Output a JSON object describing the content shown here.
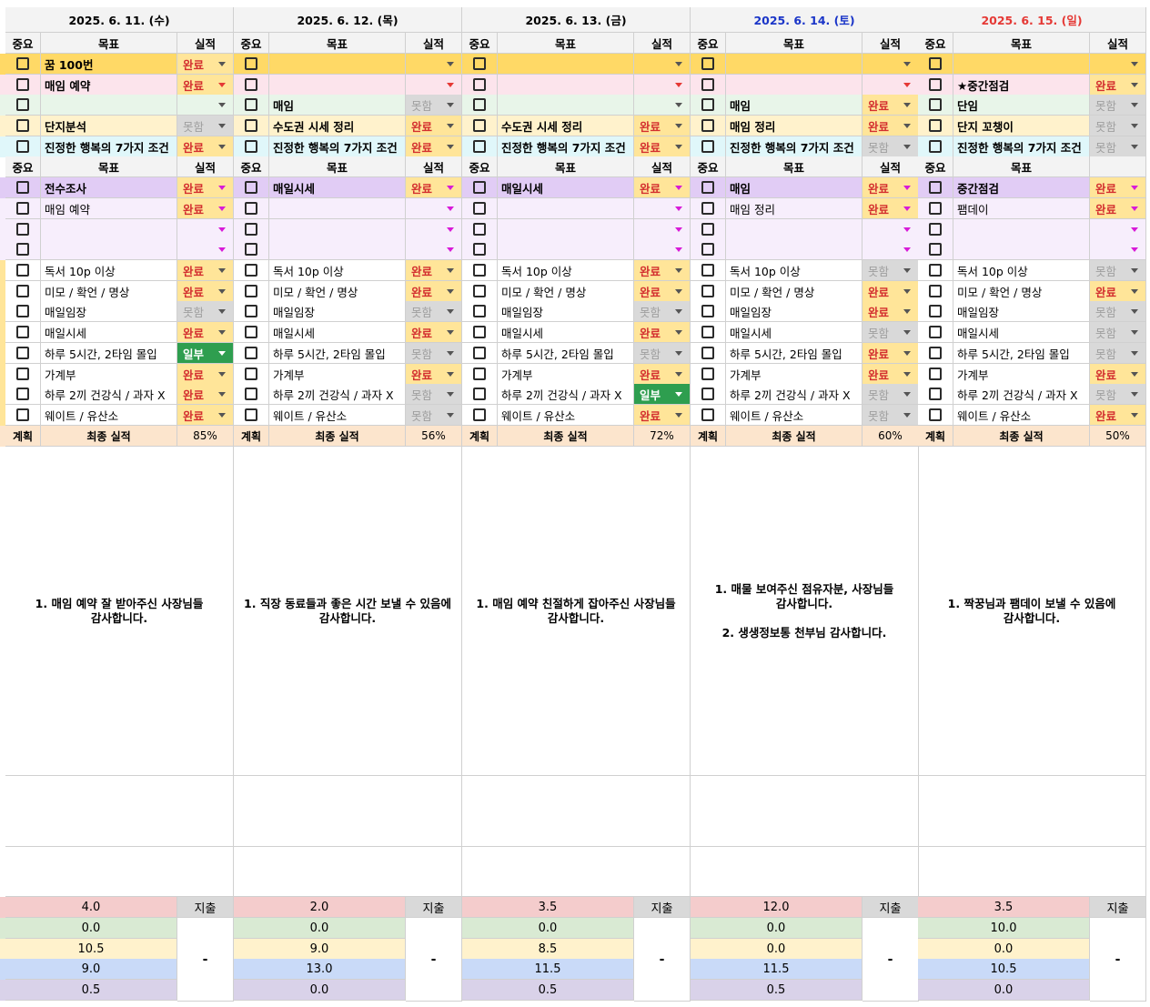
{
  "headers": {
    "importance": "중요",
    "goal": "목표",
    "result": "실적",
    "plan": "계획",
    "final": "최종 실적",
    "spend": "지출"
  },
  "days": [
    {
      "date": "2025. 6. 11. (수)",
      "date_color": "#000000",
      "top": [
        {
          "goal": "꿈 100번",
          "result": "완료",
          "bg": "#ffd966",
          "goal_bold": true,
          "caret": "dark"
        },
        {
          "goal": "매임 예약",
          "result": "완료",
          "bg": "#fce4ec",
          "goal_bold": true,
          "caret": "red"
        },
        {
          "goal": "",
          "result": "",
          "bg": "#e8f5e9",
          "goal_bold": true,
          "caret": "dark"
        },
        {
          "goal": "단지분석",
          "result": "못함",
          "bg": "#fff2cc",
          "goal_bold": true,
          "caret": "dark"
        },
        {
          "goal": "진정한 행복의 7가지 조건",
          "result": "완료",
          "bg": "#e0f7fa",
          "goal_bold": true,
          "caret": "dark"
        }
      ],
      "mid_header_result": "실적",
      "mid": [
        {
          "goal": "전수조사",
          "result": "완료",
          "bg": "#e1ccf5",
          "goal_bold": true
        },
        {
          "goal": "매임 예약",
          "result": "완료",
          "bg": "#f7eefc",
          "goal_bold": false
        },
        {
          "goal": "",
          "result": "",
          "bg": "#f7eefc",
          "goal_bold": false
        },
        {
          "goal": "",
          "result": "",
          "bg": "#f7eefc",
          "goal_bold": false
        }
      ],
      "habits": [
        "완료",
        "완료",
        "못함",
        "완료",
        "일부",
        "완료",
        "완료",
        "완료"
      ],
      "final_pct": "85%",
      "thanks": "1. 매임 예약 잘 받아주신 사장님들\n감사합니다.",
      "money": [
        "4.0",
        "0.0",
        "10.5",
        "9.0",
        "0.5"
      ]
    },
    {
      "date": "2025. 6. 12. (목)",
      "date_color": "#000000",
      "top": [
        {
          "goal": "",
          "result": "",
          "bg": "#ffd966",
          "goal_bold": true,
          "caret": "dark"
        },
        {
          "goal": "",
          "result": "",
          "bg": "#fce4ec",
          "goal_bold": true,
          "caret": "red"
        },
        {
          "goal": "매임",
          "result": "못함",
          "bg": "#e8f5e9",
          "goal_bold": true,
          "caret": "dark"
        },
        {
          "goal": "수도권 시세 정리",
          "result": "완료",
          "bg": "#fff2cc",
          "goal_bold": true,
          "caret": "dark"
        },
        {
          "goal": "진정한 행복의 7가지 조건",
          "result": "완료",
          "bg": "#e0f7fa",
          "goal_bold": true,
          "caret": "dark"
        }
      ],
      "mid_header_result": "실적",
      "mid": [
        {
          "goal": "매일시세",
          "result": "완료",
          "bg": "#e1ccf5",
          "goal_bold": true
        },
        {
          "goal": "",
          "result": "",
          "bg": "#f7eefc",
          "goal_bold": false
        },
        {
          "goal": "",
          "result": "",
          "bg": "#f7eefc",
          "goal_bold": false
        },
        {
          "goal": "",
          "result": "",
          "bg": "#f7eefc",
          "goal_bold": false
        }
      ],
      "habits": [
        "완료",
        "완료",
        "못함",
        "완료",
        "못함",
        "완료",
        "못함",
        "못함"
      ],
      "final_pct": "56%",
      "thanks": "1. 직장 동료들과 좋은 시간 보낼 수 있음에\n감사합니다.",
      "money": [
        "2.0",
        "0.0",
        "9.0",
        "13.0",
        "0.0"
      ]
    },
    {
      "date": "2025. 6. 13. (금)",
      "date_color": "#000000",
      "top": [
        {
          "goal": "",
          "result": "",
          "bg": "#ffd966",
          "goal_bold": true,
          "caret": "dark"
        },
        {
          "goal": "",
          "result": "",
          "bg": "#fce4ec",
          "goal_bold": true,
          "caret": "red"
        },
        {
          "goal": "",
          "result": "",
          "bg": "#e8f5e9",
          "goal_bold": true,
          "caret": "dark"
        },
        {
          "goal": "수도권 시세 정리",
          "result": "완료",
          "bg": "#fff2cc",
          "goal_bold": true,
          "caret": "dark"
        },
        {
          "goal": "진정한 행복의 7가지 조건",
          "result": "완료",
          "bg": "#e0f7fa",
          "goal_bold": true,
          "caret": "dark"
        }
      ],
      "mid_header_result": "실적",
      "mid": [
        {
          "goal": "매일시세",
          "result": "완료",
          "bg": "#e1ccf5",
          "goal_bold": true
        },
        {
          "goal": "",
          "result": "",
          "bg": "#f7eefc",
          "goal_bold": false
        },
        {
          "goal": "",
          "result": "",
          "bg": "#f7eefc",
          "goal_bold": false
        },
        {
          "goal": "",
          "result": "",
          "bg": "#f7eefc",
          "goal_bold": false
        }
      ],
      "habits": [
        "완료",
        "완료",
        "못함",
        "완료",
        "못함",
        "완료",
        "일부",
        "완료"
      ],
      "final_pct": "72%",
      "thanks": "1. 매임 예약 친절하게 잡아주신 사장님들\n감사합니다.",
      "money": [
        "3.5",
        "0.0",
        "8.5",
        "11.5",
        "0.5"
      ]
    },
    {
      "date": "2025. 6. 14. (토)",
      "date_color": "#1a35c8",
      "top": [
        {
          "goal": "",
          "result": "",
          "bg": "#ffd966",
          "goal_bold": true,
          "caret": "dark"
        },
        {
          "goal": "",
          "result": "",
          "bg": "#fce4ec",
          "goal_bold": true,
          "caret": "red"
        },
        {
          "goal": "매임",
          "result": "완료",
          "bg": "#e8f5e9",
          "goal_bold": true,
          "caret": "dark"
        },
        {
          "goal": "매임 정리",
          "result": "완료",
          "bg": "#fff2cc",
          "goal_bold": true,
          "caret": "dark"
        },
        {
          "goal": "진정한 행복의 7가지 조건",
          "result": "못함",
          "bg": "#e0f7fa",
          "goal_bold": true,
          "caret": "dark"
        }
      ],
      "mid_header_result": "실적",
      "mid": [
        {
          "goal": "매임",
          "result": "완료",
          "bg": "#e1ccf5",
          "goal_bold": true
        },
        {
          "goal": "매임 정리",
          "result": "완료",
          "bg": "#f7eefc",
          "goal_bold": false
        },
        {
          "goal": "",
          "result": "",
          "bg": "#f7eefc",
          "goal_bold": false
        },
        {
          "goal": "",
          "result": "",
          "bg": "#f7eefc",
          "goal_bold": false
        }
      ],
      "habits": [
        "못함",
        "완료",
        "완료",
        "못함",
        "완료",
        "완료",
        "못함",
        "못함"
      ],
      "final_pct": "60%",
      "thanks": "1. 매물 보여주신 점유자분, 사장님들\n감사합니다.\n\n2. 생생정보통 천부님 감사합니다.",
      "money": [
        "12.0",
        "0.0",
        "0.0",
        "11.5",
        "0.5"
      ]
    },
    {
      "date": "2025. 6. 15. (일)",
      "date_color": "#e53935",
      "top": [
        {
          "goal": "",
          "result": "",
          "bg": "#ffd966",
          "goal_bold": true,
          "caret": "dark"
        },
        {
          "goal": "★중간점검",
          "result": "완료",
          "bg": "#fce4ec",
          "goal_bold": true,
          "caret": "dark"
        },
        {
          "goal": "단임",
          "result": "못함",
          "bg": "#e8f5e9",
          "goal_bold": true,
          "caret": "dark"
        },
        {
          "goal": "단지 꼬챙이",
          "result": "못함",
          "bg": "#fff2cc",
          "goal_bold": true,
          "caret": "dark"
        },
        {
          "goal": "진정한 행복의 7가지 조건",
          "result": "못함",
          "bg": "#e0f7fa",
          "goal_bold": true,
          "caret": "dark"
        }
      ],
      "mid_header_result": "",
      "mid": [
        {
          "goal": "중간점검",
          "result": "완료",
          "bg": "#e1ccf5",
          "goal_bold": true
        },
        {
          "goal": "팸데이",
          "result": "완료",
          "bg": "#f7eefc",
          "goal_bold": false
        },
        {
          "goal": "",
          "result": "",
          "bg": "#f7eefc",
          "goal_bold": false
        },
        {
          "goal": "",
          "result": "",
          "bg": "#f7eefc",
          "goal_bold": false
        }
      ],
      "habits": [
        "못함",
        "완료",
        "못함",
        "못함",
        "못함",
        "완료",
        "못함",
        "완료"
      ],
      "final_pct": "50%",
      "thanks": "1. 짝꿍님과 팸데이 보낼 수 있음에\n감사합니다.",
      "money": [
        "3.5",
        "10.0",
        "0.0",
        "10.5",
        "0.0"
      ]
    }
  ],
  "habit_names": [
    "독서 10p 이상",
    "미모 / 확언 / 명상",
    "매일임장",
    "매일시세",
    "하루 5시간, 2타임 몰입",
    "가계부",
    "하루 2끼 건강식 / 과자 X",
    "웨이트 / 유산소"
  ],
  "money_colors": [
    "#f4cccc",
    "#d9ead3",
    "#fff2cc",
    "#c9daf8",
    "#d9d2e9"
  ],
  "money_dash": "-"
}
